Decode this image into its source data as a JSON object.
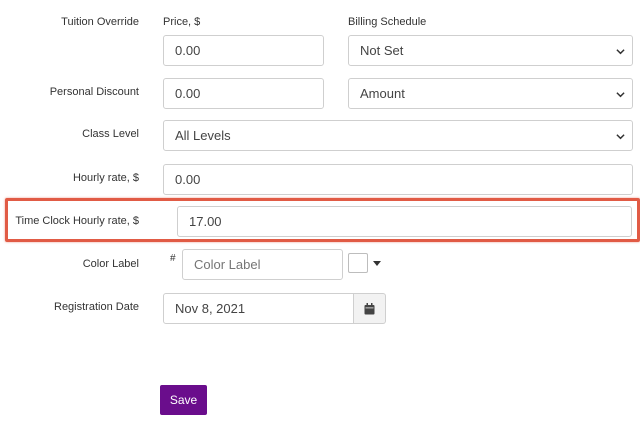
{
  "form": {
    "tuition_override": {
      "label": "Tuition Override",
      "price_label": "Price, $",
      "price_value": "0.00",
      "billing_label": "Billing Schedule",
      "billing_value": "Not Set"
    },
    "personal_discount": {
      "label": "Personal Discount",
      "value": "0.00",
      "type_value": "Amount"
    },
    "class_level": {
      "label": "Class Level",
      "value": "All Levels"
    },
    "hourly_rate": {
      "label": "Hourly rate, $",
      "value": "0.00"
    },
    "time_clock_hourly_rate": {
      "label": "Time Clock Hourly rate, $",
      "value": "17.00"
    },
    "color_label": {
      "label": "Color Label",
      "hash": "#",
      "placeholder": "Color Label"
    },
    "registration_date": {
      "label": "Registration Date",
      "value": "Nov 8, 2021"
    },
    "save_label": "Save"
  },
  "colors": {
    "highlight": "#e15b45",
    "save_button": "#6a0d8c"
  }
}
